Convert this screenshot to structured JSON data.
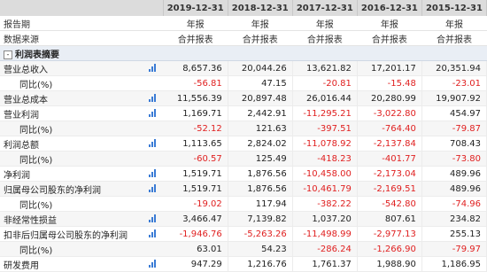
{
  "years": [
    "2019-12-31",
    "2018-12-31",
    "2017-12-31",
    "2016-12-31",
    "2015-12-31"
  ],
  "meta": [
    {
      "label": "报告期",
      "values": [
        "年报",
        "年报",
        "年报",
        "年报",
        "年报"
      ]
    },
    {
      "label": "数据来源",
      "values": [
        "合并报表",
        "合并报表",
        "合并报表",
        "合并报表",
        "合并报表"
      ]
    }
  ],
  "section": {
    "toggle": "-",
    "title": "利润表摘要"
  },
  "rows": [
    {
      "label": "营业总收入",
      "chart": true,
      "values": [
        "8,657.36",
        "20,044.26",
        "13,621.82",
        "17,201.17",
        "20,351.94"
      ]
    },
    {
      "label": "同比(%)",
      "sub": true,
      "values": [
        "-56.81",
        "47.15",
        "-20.81",
        "-15.48",
        "-23.01"
      ]
    },
    {
      "label": "营业总成本",
      "chart": true,
      "values": [
        "11,556.39",
        "20,897.48",
        "26,016.44",
        "20,280.99",
        "19,907.92"
      ]
    },
    {
      "label": "营业利润",
      "chart": true,
      "values": [
        "1,169.71",
        "2,442.91",
        "-11,295.21",
        "-3,022.80",
        "454.97"
      ]
    },
    {
      "label": "同比(%)",
      "sub": true,
      "values": [
        "-52.12",
        "121.63",
        "-397.51",
        "-764.40",
        "-79.87"
      ]
    },
    {
      "label": "利润总额",
      "chart": true,
      "values": [
        "1,113.65",
        "2,824.02",
        "-11,078.92",
        "-2,137.84",
        "708.43"
      ]
    },
    {
      "label": "同比(%)",
      "sub": true,
      "values": [
        "-60.57",
        "125.49",
        "-418.23",
        "-401.77",
        "-73.80"
      ]
    },
    {
      "label": "净利润",
      "chart": true,
      "values": [
        "1,519.71",
        "1,876.56",
        "-10,458.00",
        "-2,173.04",
        "489.96"
      ]
    },
    {
      "label": "归属母公司股东的净利润",
      "chart": true,
      "values": [
        "1,519.71",
        "1,876.56",
        "-10,461.79",
        "-2,169.51",
        "489.96"
      ]
    },
    {
      "label": "同比(%)",
      "sub": true,
      "values": [
        "-19.02",
        "117.94",
        "-382.22",
        "-542.80",
        "-74.96"
      ]
    },
    {
      "label": "非经常性损益",
      "chart": true,
      "values": [
        "3,466.47",
        "7,139.82",
        "1,037.20",
        "807.61",
        "234.82"
      ]
    },
    {
      "label": "扣非后归属母公司股东的净利润",
      "chart": true,
      "values": [
        "-1,946.76",
        "-5,263.26",
        "-11,498.99",
        "-2,977.13",
        "255.13"
      ]
    },
    {
      "label": "同比(%)",
      "sub": true,
      "values": [
        "63.01",
        "54.23",
        "-286.24",
        "-1,266.90",
        "-79.97"
      ]
    },
    {
      "label": "研发费用",
      "chart": true,
      "values": [
        "947.29",
        "1,216.76",
        "1,761.37",
        "1,988.90",
        "1,186.95"
      ]
    }
  ]
}
